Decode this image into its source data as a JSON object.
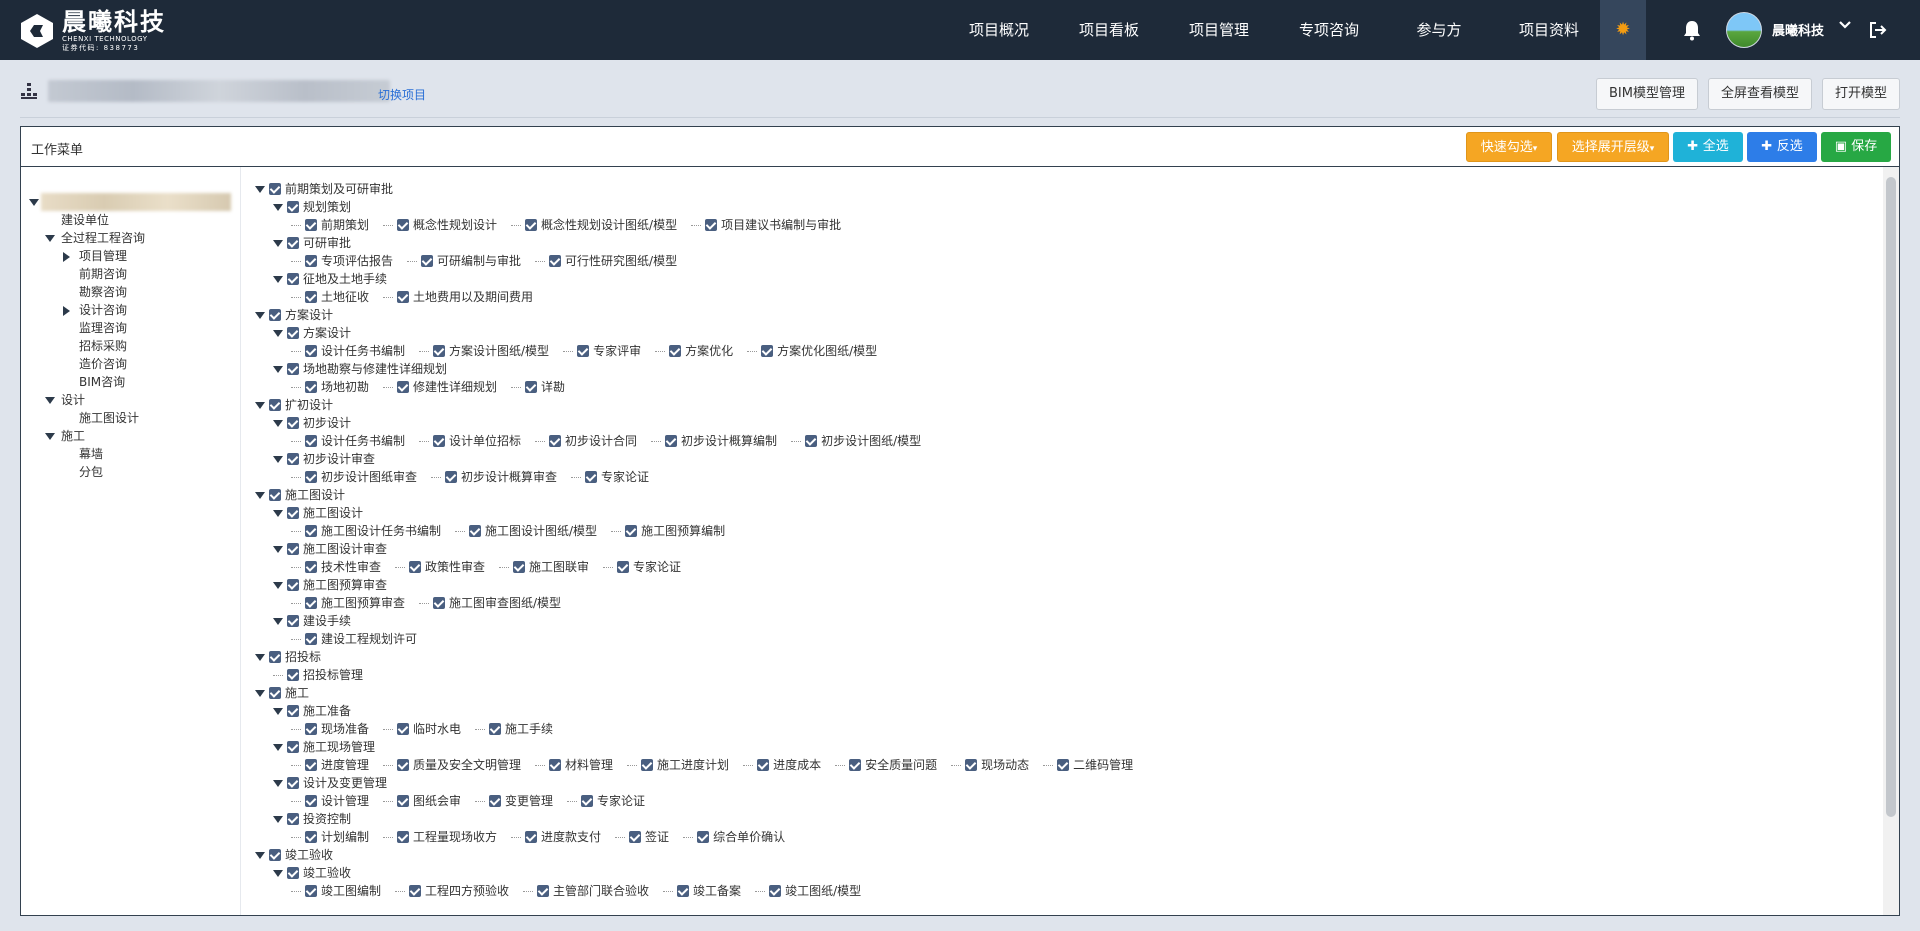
{
  "brand": {
    "title": "晨曦科技",
    "subtitle": "CHENXI TECHNOLOGY",
    "code": "证券代码: 838773"
  },
  "nav": [
    "项目概况",
    "项目看板",
    "项目管理",
    "专项咨询",
    "参与方",
    "项目资料"
  ],
  "user": {
    "name": "晨曦科技"
  },
  "colors": {
    "topbar": "#1e2a39",
    "accent": "#f39c12",
    "link": "#2a6fd6"
  },
  "subheader": {
    "switch_label": "切换项目",
    "btn_bim": "BIM模型管理",
    "btn_fullscreen": "全屏查看模型",
    "btn_open": "打开模型"
  },
  "panel": {
    "title": "工作菜单",
    "btn_quick": "快速勾选",
    "btn_expand": "选择展开层级",
    "btn_all": "全选",
    "btn_invert": "反选",
    "btn_save": "保存"
  },
  "left_tree": [
    {
      "label": "建设单位",
      "level": 1,
      "expander": "none"
    },
    {
      "label": "全过程工程咨询",
      "level": 1,
      "expander": "down"
    },
    {
      "label": "项目管理",
      "level": 2,
      "expander": "right"
    },
    {
      "label": "前期咨询",
      "level": 2,
      "expander": "none"
    },
    {
      "label": "勘察咨询",
      "level": 2,
      "expander": "none"
    },
    {
      "label": "设计咨询",
      "level": 2,
      "expander": "right"
    },
    {
      "label": "监理咨询",
      "level": 2,
      "expander": "none"
    },
    {
      "label": "招标采购",
      "level": 2,
      "expander": "none"
    },
    {
      "label": "造价咨询",
      "level": 2,
      "expander": "none"
    },
    {
      "label": "BIM咨询",
      "level": 2,
      "expander": "none"
    },
    {
      "label": "设计",
      "level": 1,
      "expander": "down"
    },
    {
      "label": "施工图设计",
      "level": 2,
      "expander": "none"
    },
    {
      "label": "施工",
      "level": 1,
      "expander": "down"
    },
    {
      "label": "幕墙",
      "level": 2,
      "expander": "none"
    },
    {
      "label": "分包",
      "level": 2,
      "expander": "none"
    }
  ],
  "right_tree": [
    {
      "type": "group",
      "level": 0,
      "label": "前期策划及可研审批"
    },
    {
      "type": "group",
      "level": 1,
      "label": "规划策划"
    },
    {
      "type": "leaves",
      "items": [
        "前期策划",
        "概念性规划设计",
        "概念性规划设计图纸/模型",
        "项目建议书编制与审批"
      ]
    },
    {
      "type": "group",
      "level": 1,
      "label": "可研审批"
    },
    {
      "type": "leaves",
      "items": [
        "专项评估报告",
        "可研编制与审批",
        "可行性研究图纸/模型"
      ]
    },
    {
      "type": "group",
      "level": 1,
      "label": "征地及土地手续"
    },
    {
      "type": "leaves",
      "items": [
        "土地征收",
        "土地费用以及期间费用"
      ]
    },
    {
      "type": "group",
      "level": 0,
      "label": "方案设计"
    },
    {
      "type": "group",
      "level": 1,
      "label": "方案设计"
    },
    {
      "type": "leaves",
      "items": [
        "设计任务书编制",
        "方案设计图纸/模型",
        "专家评审",
        "方案优化",
        "方案优化图纸/模型"
      ]
    },
    {
      "type": "group",
      "level": 1,
      "label": "场地勘察与修建性详细规划"
    },
    {
      "type": "leaves",
      "items": [
        "场地初勘",
        "修建性详细规划",
        "详勘"
      ]
    },
    {
      "type": "group",
      "level": 0,
      "label": "扩初设计"
    },
    {
      "type": "group",
      "level": 1,
      "label": "初步设计"
    },
    {
      "type": "leaves",
      "items": [
        "设计任务书编制",
        "设计单位招标",
        "初步设计合同",
        "初步设计概算编制",
        "初步设计图纸/模型"
      ]
    },
    {
      "type": "group",
      "level": 1,
      "label": "初步设计审查"
    },
    {
      "type": "leaves",
      "items": [
        "初步设计图纸审查",
        "初步设计概算审查",
        "专家论证"
      ]
    },
    {
      "type": "group",
      "level": 0,
      "label": "施工图设计"
    },
    {
      "type": "group",
      "level": 1,
      "label": "施工图设计"
    },
    {
      "type": "leaves",
      "items": [
        "施工图设计任务书编制",
        "施工图设计图纸/模型",
        "施工图预算编制"
      ]
    },
    {
      "type": "group",
      "level": 1,
      "label": "施工图设计审查"
    },
    {
      "type": "leaves",
      "items": [
        "技术性审查",
        "政策性审查",
        "施工图联审",
        "专家论证"
      ]
    },
    {
      "type": "group",
      "level": 1,
      "label": "施工图预算审查"
    },
    {
      "type": "leaves",
      "items": [
        "施工图预算审查",
        "施工图审查图纸/模型"
      ]
    },
    {
      "type": "group",
      "level": 1,
      "label": "建设手续"
    },
    {
      "type": "leaves",
      "items": [
        "建设工程规划许可"
      ]
    },
    {
      "type": "group",
      "level": 0,
      "label": "招投标"
    },
    {
      "type": "leaves1",
      "items": [
        "招投标管理"
      ]
    },
    {
      "type": "group",
      "level": 0,
      "label": "施工"
    },
    {
      "type": "group",
      "level": 1,
      "label": "施工准备"
    },
    {
      "type": "leaves",
      "items": [
        "现场准备",
        "临时水电",
        "施工手续"
      ]
    },
    {
      "type": "group",
      "level": 1,
      "label": "施工现场管理"
    },
    {
      "type": "leaves",
      "items": [
        "进度管理",
        "质量及安全文明管理",
        "材料管理",
        "施工进度计划",
        "进度成本",
        "安全质量问题",
        "现场动态",
        "二维码管理"
      ]
    },
    {
      "type": "group",
      "level": 1,
      "label": "设计及变更管理"
    },
    {
      "type": "leaves",
      "items": [
        "设计管理",
        "图纸会审",
        "变更管理",
        "专家论证"
      ]
    },
    {
      "type": "group",
      "level": 1,
      "label": "投资控制"
    },
    {
      "type": "leaves",
      "items": [
        "计划编制",
        "工程量现场收方",
        "进度款支付",
        "签证",
        "综合单价确认"
      ]
    },
    {
      "type": "group",
      "level": 0,
      "label": "竣工验收"
    },
    {
      "type": "group",
      "level": 1,
      "label": "竣工验收"
    },
    {
      "type": "leaves",
      "items": [
        "竣工图编制",
        "工程四方预验收",
        "主管部门联合验收",
        "竣工备案",
        "竣工图纸/模型"
      ]
    }
  ]
}
